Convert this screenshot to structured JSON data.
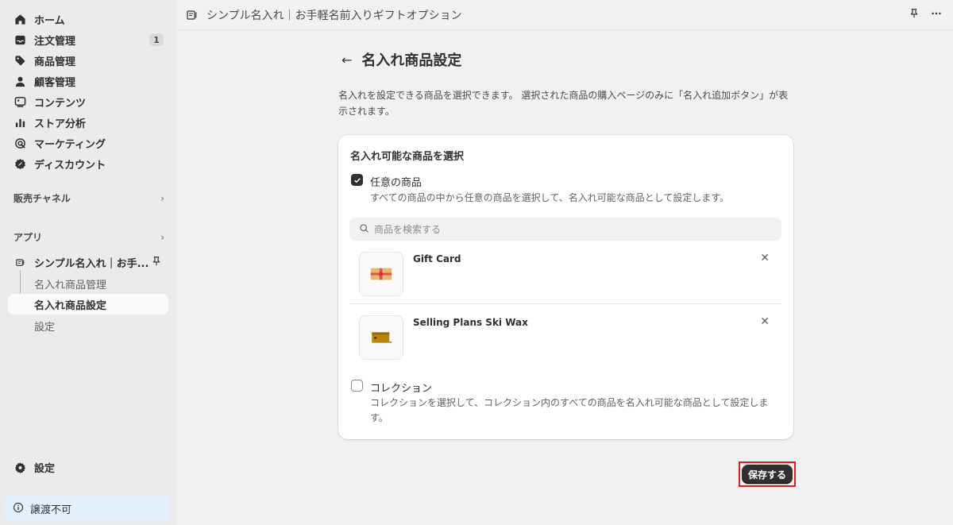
{
  "sidebar": {
    "nav": [
      {
        "label": "ホーム",
        "icon": "home-icon"
      },
      {
        "label": "注文管理",
        "icon": "inbox-icon",
        "badge": "1"
      },
      {
        "label": "商品管理",
        "icon": "tag-icon"
      },
      {
        "label": "顧客管理",
        "icon": "person-icon"
      },
      {
        "label": "コンテンツ",
        "icon": "content-icon"
      },
      {
        "label": "ストア分析",
        "icon": "bar-chart-icon"
      },
      {
        "label": "マーケティング",
        "icon": "target-icon"
      },
      {
        "label": "ディスカウント",
        "icon": "discount-icon"
      }
    ],
    "sales_channels": "販売チャネル",
    "apps": "アプリ",
    "app_name": "シンプル名入れ｜お手...",
    "app_subitems": [
      "名入れ商品管理",
      "名入れ商品設定",
      "設定"
    ],
    "settings": "設定",
    "non_transferable": "譲渡不可"
  },
  "topbar": {
    "title": "シンプル名入れ｜お手軽名前入りギフトオプション"
  },
  "page": {
    "title": "名入れ商品設定",
    "description": "名入れを設定できる商品を選択できます。 選択された商品の購入ページのみに「名入れ追加ボタン」が表示されます。"
  },
  "card": {
    "title": "名入れ可能な商品を選択",
    "option_any": {
      "label": "任意の商品",
      "help": "すべての商品の中から任意の商品を選択して、名入れ可能な商品として設定します。",
      "checked": true
    },
    "search_placeholder": "商品を検索する",
    "products": [
      {
        "name": "Gift Card"
      },
      {
        "name": "Selling Plans Ski Wax"
      }
    ],
    "option_collection": {
      "label": "コレクション",
      "help": "コレクションを選択して、コレクション内のすべての商品を名入れ可能な商品として設定します。",
      "checked": false
    }
  },
  "save_button": "保存する"
}
